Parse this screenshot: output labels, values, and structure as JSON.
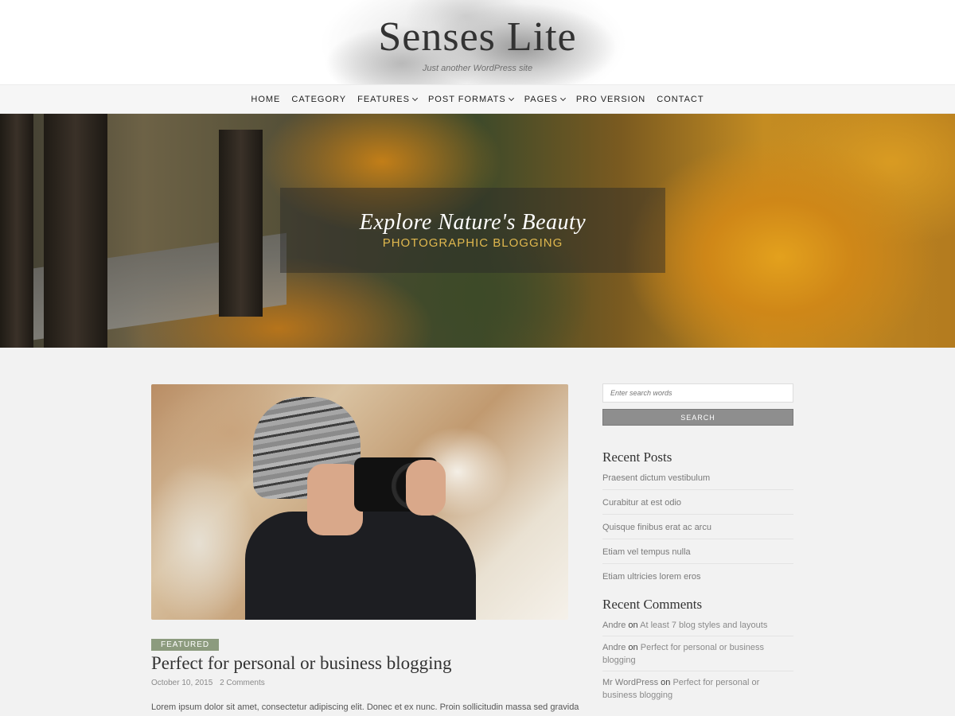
{
  "header": {
    "site_title": "Senses Lite",
    "tagline": "Just another WordPress site"
  },
  "nav": {
    "items": [
      {
        "label": "HOME",
        "has_dropdown": false
      },
      {
        "label": "CATEGORY",
        "has_dropdown": false
      },
      {
        "label": "FEATURES",
        "has_dropdown": true
      },
      {
        "label": "POST FORMATS",
        "has_dropdown": true
      },
      {
        "label": "PAGES",
        "has_dropdown": true
      },
      {
        "label": "PRO VERSION",
        "has_dropdown": false
      },
      {
        "label": "CONTACT",
        "has_dropdown": false
      }
    ]
  },
  "hero": {
    "title": "Explore Nature's Beauty",
    "subtitle": "PHOTOGRAPHIC BLOGGING"
  },
  "post": {
    "category_badge": "FEATURED",
    "title": "Perfect for personal or business blogging",
    "date": "October 10, 2015",
    "comments": "2 Comments",
    "excerpt": "Lorem ipsum dolor sit amet, consectetur adipiscing elit. Donec et ex nunc. Proin sollicitudin massa sed gravida"
  },
  "sidebar": {
    "search": {
      "placeholder": "Enter search words",
      "button_label": "SEARCH"
    },
    "recent_posts": {
      "title": "Recent Posts",
      "items": [
        "Praesent dictum vestibulum",
        "Curabitur at est odio",
        "Quisque finibus erat ac arcu",
        "Etiam vel tempus nulla",
        "Etiam ultricies lorem eros"
      ]
    },
    "recent_comments": {
      "title": "Recent Comments",
      "items": [
        {
          "author": "Andre",
          "on": "on",
          "post": "At least 7 blog styles and layouts"
        },
        {
          "author": "Andre",
          "on": "on",
          "post": "Perfect for personal or business blogging"
        },
        {
          "author": "Mr WordPress",
          "on": "on",
          "post": "Perfect for personal or business blogging"
        }
      ]
    }
  },
  "colors": {
    "badge": "#8c9b7e",
    "hero_subtitle": "#e0b84e",
    "search_button": "#8e8e8e"
  }
}
